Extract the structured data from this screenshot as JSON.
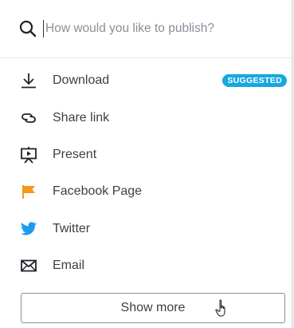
{
  "search": {
    "placeholder": "How would you like to publish?"
  },
  "options": [
    {
      "label": "Download",
      "icon": "download-icon",
      "badge": "SUGGESTED"
    },
    {
      "label": "Share link",
      "icon": "link-icon"
    },
    {
      "label": "Present",
      "icon": "present-icon"
    },
    {
      "label": "Facebook Page",
      "icon": "facebook-flag-icon",
      "icon_color": "#f7951d"
    },
    {
      "label": "Twitter",
      "icon": "twitter-icon",
      "icon_color": "#1d9bf0"
    },
    {
      "label": "Email",
      "icon": "email-icon"
    }
  ],
  "show_more_label": "Show more",
  "colors": {
    "badge_bg": "#16a8e0",
    "text": "#3c3f44"
  }
}
